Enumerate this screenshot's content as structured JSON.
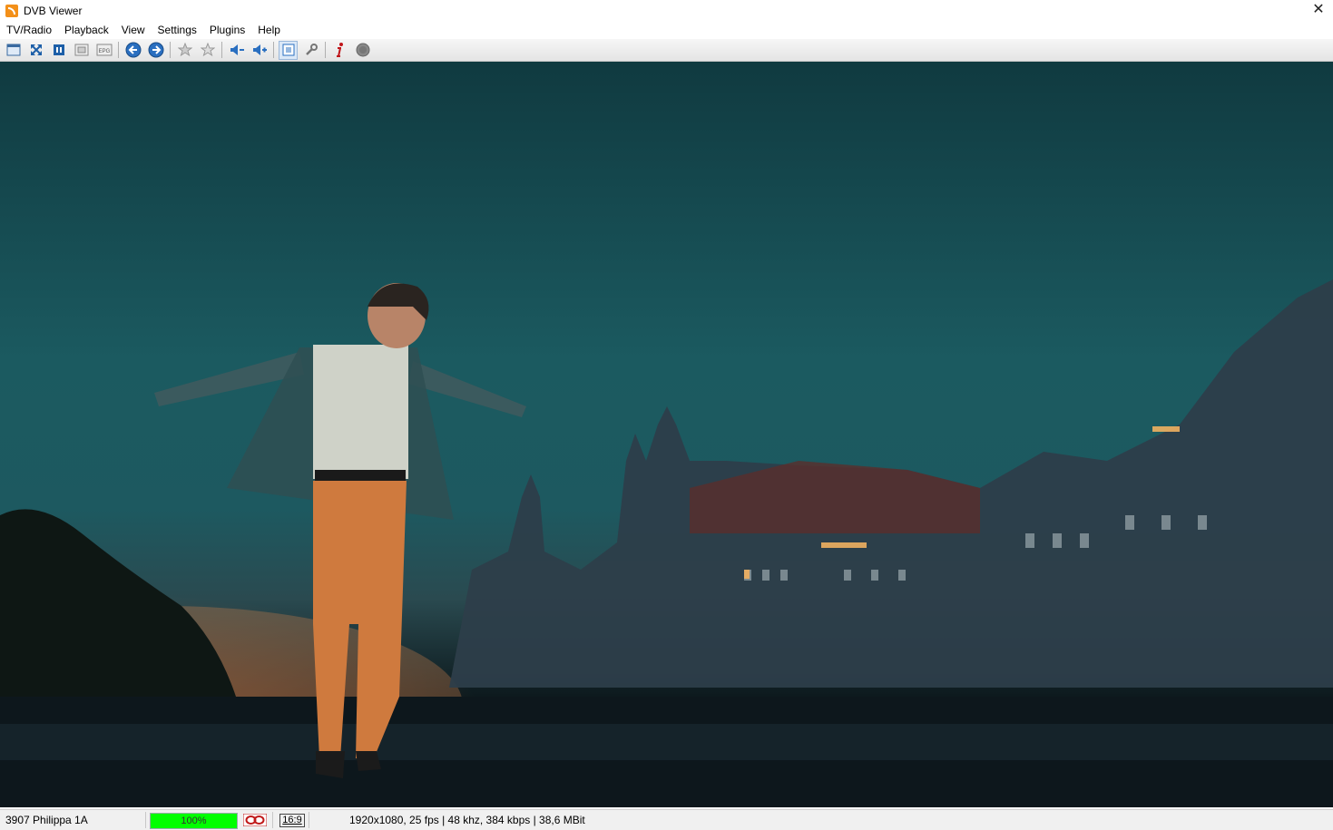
{
  "window": {
    "title": "DVB Viewer",
    "close_glyph": "✕"
  },
  "menu": [
    {
      "label": "TV/Radio"
    },
    {
      "label": "Playback"
    },
    {
      "label": "View"
    },
    {
      "label": "Settings"
    },
    {
      "label": "Plugins"
    },
    {
      "label": "Help"
    }
  ],
  "toolbar": {
    "buttons": [
      {
        "icon": "window-icon"
      },
      {
        "icon": "fullscreen-icon"
      },
      {
        "icon": "teletext-icon"
      },
      {
        "icon": "osd-icon"
      },
      {
        "icon": "epg-icon"
      },
      {
        "icon": "back-icon"
      },
      {
        "icon": "forward-icon"
      },
      {
        "icon": "favorite-icon"
      },
      {
        "icon": "favorite-add-icon"
      },
      {
        "icon": "volume-down-icon"
      },
      {
        "icon": "volume-up-icon"
      },
      {
        "icon": "channel-list-icon"
      },
      {
        "icon": "settings-wrench-icon"
      },
      {
        "icon": "info-icon"
      },
      {
        "icon": "record-icon"
      }
    ],
    "epg_label": "EPG"
  },
  "status": {
    "channel": "3907 Philippa 1A",
    "signal_strength": "100%",
    "signal_level": 1.0,
    "signal_color": "#00ff00",
    "aspect": "16:9",
    "stream_info": "1920x1080, 25 fps | 48 khz, 384 kbps | 38,6 MBit"
  }
}
